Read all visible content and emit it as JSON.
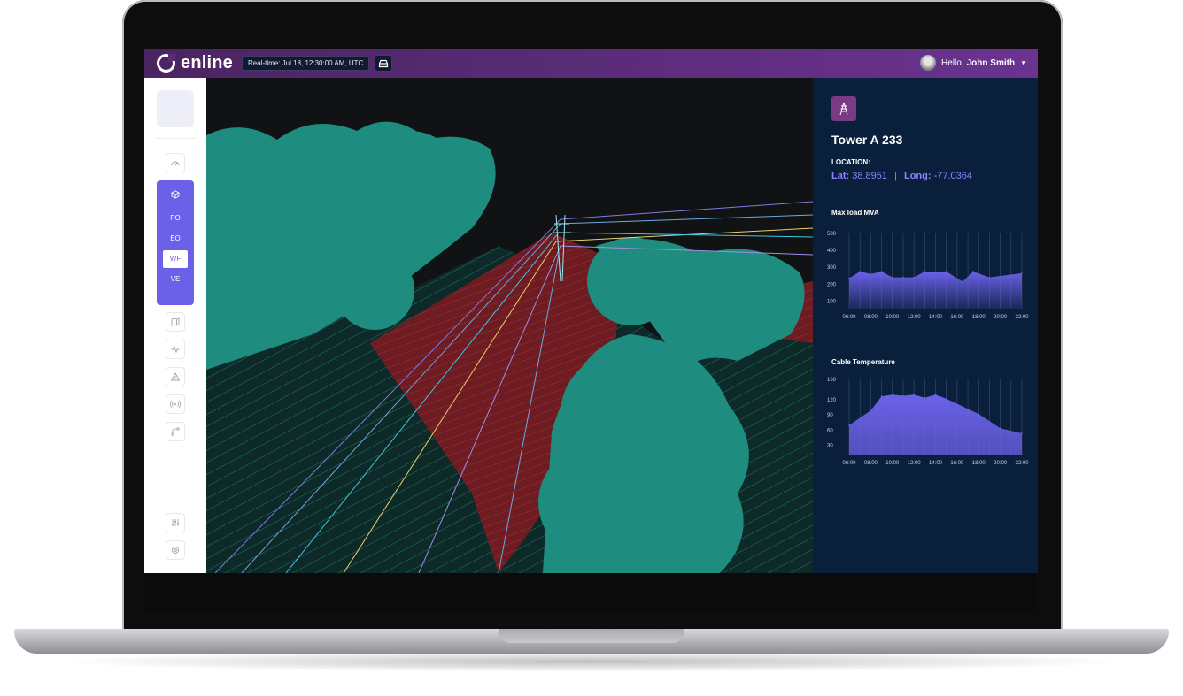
{
  "header": {
    "logo_text": "enline",
    "realtime_label": "Real-time: Jul 18, 12:30:00 AM, UTC",
    "greeting": "Hello,",
    "user_name": "John Smith"
  },
  "sidebar": {
    "top_icons": [
      "gauge-icon"
    ],
    "active_group": {
      "icon": "cube-icon",
      "items": [
        {
          "label": "PO",
          "active": false
        },
        {
          "label": "EO",
          "active": false
        },
        {
          "label": "WF",
          "active": true
        },
        {
          "label": "VE",
          "active": false
        }
      ]
    },
    "icons": [
      "map-icon",
      "pulse-icon",
      "warning-icon",
      "broadcast-icon",
      "route-icon"
    ],
    "bottom_icons": [
      "sliders-icon",
      "settings-icon"
    ]
  },
  "panel": {
    "icon": "transmission-tower-icon",
    "title": "Tower A 233",
    "location_label": "LOCATION:",
    "lat_label": "Lat:",
    "lat_value": "38.8951",
    "long_label": "Long:",
    "long_value": "-77.0364"
  },
  "chart_data": [
    {
      "type": "area",
      "title": "Max load MVA",
      "x": [
        "06:00",
        "07:00",
        "08:00",
        "09:00",
        "10:00",
        "11:00",
        "12:00",
        "13:00",
        "14:00",
        "15:00",
        "16:00",
        "17:00",
        "18:00",
        "19:00",
        "20:00",
        "21:00",
        "22:00"
      ],
      "x_ticks": [
        "06:00",
        "08:00",
        "10:00",
        "12:00",
        "14:00",
        "16:00",
        "18:00",
        "20:00",
        "22:00"
      ],
      "values": [
        230,
        270,
        255,
        270,
        235,
        235,
        235,
        270,
        270,
        210,
        270,
        235,
        260
      ],
      "value_x": [
        "06:00",
        "07:00",
        "08:00",
        "09:00",
        "10:00",
        "11:00",
        "12:00",
        "13:00",
        "15:00",
        "16:30",
        "17:30",
        "19:00",
        "22:00"
      ],
      "y_ticks": [
        100,
        200,
        300,
        400,
        500
      ],
      "ylim": [
        50,
        500
      ],
      "grid": "vertical"
    },
    {
      "type": "area",
      "title": "Cable Temperature",
      "x_ticks": [
        "06:00",
        "08:00",
        "10:00",
        "12:00",
        "14:00",
        "16:00",
        "18:00",
        "20:00",
        "22:00"
      ],
      "values": [
        68,
        97,
        125,
        128,
        126,
        128,
        122,
        128,
        120,
        90,
        62,
        52
      ],
      "value_x": [
        "06:00",
        "08:00",
        "09:00",
        "10:00",
        "11:00",
        "12:00",
        "13:00",
        "14:00",
        "15:00",
        "18:00",
        "20:00",
        "22:00"
      ],
      "y_ticks": [
        30,
        60,
        90,
        120,
        160
      ],
      "ylim": [
        10,
        160
      ],
      "grid": "vertical"
    }
  ],
  "colors": {
    "accent": "#6b61e8",
    "panel_bg": "#0a1f3c",
    "header_bg": "#5e2d7d",
    "vegetation": "#1f8c80",
    "danger_zone": "#7a1f23"
  }
}
